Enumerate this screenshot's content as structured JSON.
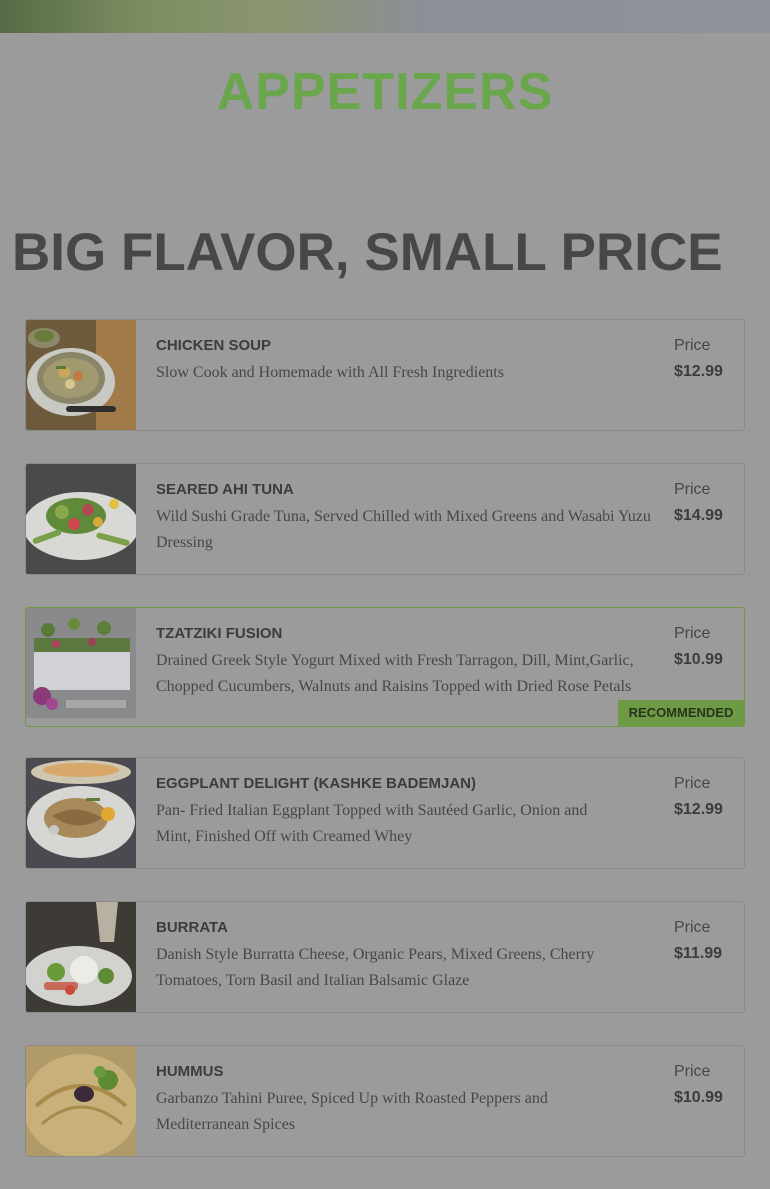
{
  "section": {
    "title": "APPETIZERS"
  },
  "tagline": "BIG FLAVOR, SMALL PRICE",
  "items": [
    {
      "name": "CHICKEN SOUP",
      "description": "Slow Cook and Homemade with All Fresh Ingredients",
      "price_label": "Price",
      "price": "$12.99",
      "image_icon": "chicken-soup-photo"
    },
    {
      "name": "SEARED AHI TUNA",
      "description": "Wild Sushi Grade Tuna, Served Chilled with Mixed Greens and  Wasabi Yuzu Dressing",
      "price_label": "Price",
      "price": "$14.99",
      "image_icon": "ahi-tuna-photo"
    },
    {
      "name": "TZATZIKI FUSION",
      "description": "Drained Greek Style Yogurt Mixed with Fresh Tarragon, Dill, Mint,Garlic, Chopped Cucumbers, Walnuts and Raisins Topped with Dried Rose Petals",
      "price_label": "Price",
      "price": "$10.99",
      "badge": "RECOMMENDED",
      "image_icon": "tzatziki-photo"
    },
    {
      "name": "EGGPLANT DELIGHT (KASHKE BADEMJAN)",
      "description": " Pan- Fried Italian Eggplant Topped with Sautéed Garlic, Onion and Mint, Finished Off with Creamed Whey",
      "price_label": "Price",
      "price": "$12.99",
      "image_icon": "eggplant-photo"
    },
    {
      "name": "BURRATA",
      "description": "Danish Style Burratta Cheese, Organic Pears, Mixed Greens, Cherry Tomatoes, Torn Basil and Italian Balsamic Glaze",
      "price_label": "Price",
      "price": "$11.99",
      "image_icon": "burrata-photo"
    },
    {
      "name": "HUMMUS",
      "description": "Garbanzo Tahini Puree, Spiced Up with Roasted Peppers and Mediterranean Spices",
      "price_label": "Price",
      "price": "$10.99",
      "image_icon": "hummus-photo"
    }
  ],
  "colors": {
    "accent": "#6aa64c",
    "overlay_background": "#9b9b9b",
    "badge": "#6e9a46"
  }
}
